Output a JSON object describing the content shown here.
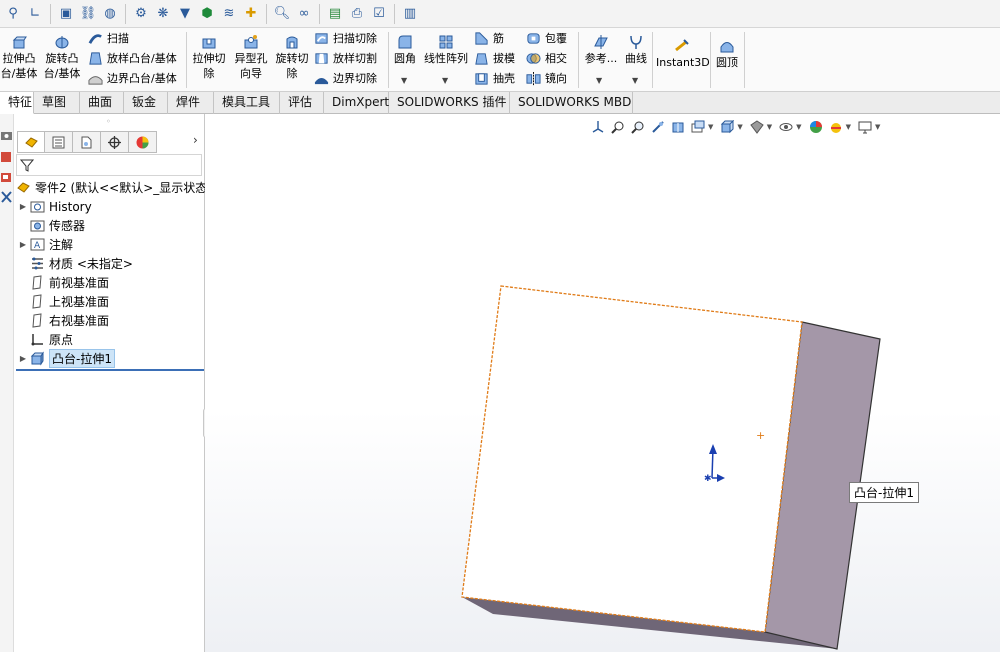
{
  "ribbon": {
    "extrude_boss": "拉伸凸\n台/基体",
    "revolve_boss": "旋转凸\n台/基体",
    "sweep": "扫描",
    "loft": "放样凸台/基体",
    "boundary": "边界凸台/基体",
    "extrude_cut": "拉伸切\n除",
    "hole_wizard": "异型孔\n向导",
    "revolve_cut": "旋转切\n除",
    "sweep_cut": "扫描切除",
    "loft_cut": "放样切割",
    "boundary_cut": "边界切除",
    "fillet": "圆角",
    "linear_pattern": "线性阵列",
    "rib": "筋",
    "draft": "拔模",
    "shell": "抽壳",
    "wrap": "包覆",
    "intersect": "相交",
    "mirror": "镜向",
    "reference": "参考...",
    "curves": "曲线",
    "instant3d": "Instant3D",
    "dome": "圆顶"
  },
  "tabs": [
    "特征",
    "草图",
    "曲面",
    "钣金",
    "焊件",
    "模具工具",
    "评估",
    "DimXpert",
    "SOLIDWORKS 插件",
    "SOLIDWORKS MBD"
  ],
  "tree": {
    "root": "零件2 (默认<<默认>_显示状态",
    "items": [
      "History",
      "传感器",
      "注解",
      "材质 <未指定>",
      "前视基准面",
      "上视基准面",
      "右视基准面",
      "原点",
      "凸台-拉伸1"
    ]
  },
  "viewport": {
    "tooltip": "凸台-拉伸1"
  },
  "colors": {
    "face_front": "#ffffff",
    "face_side": "#a497a8",
    "edge_selected": "#e07b17",
    "selection_bg": "#cde4f7"
  }
}
